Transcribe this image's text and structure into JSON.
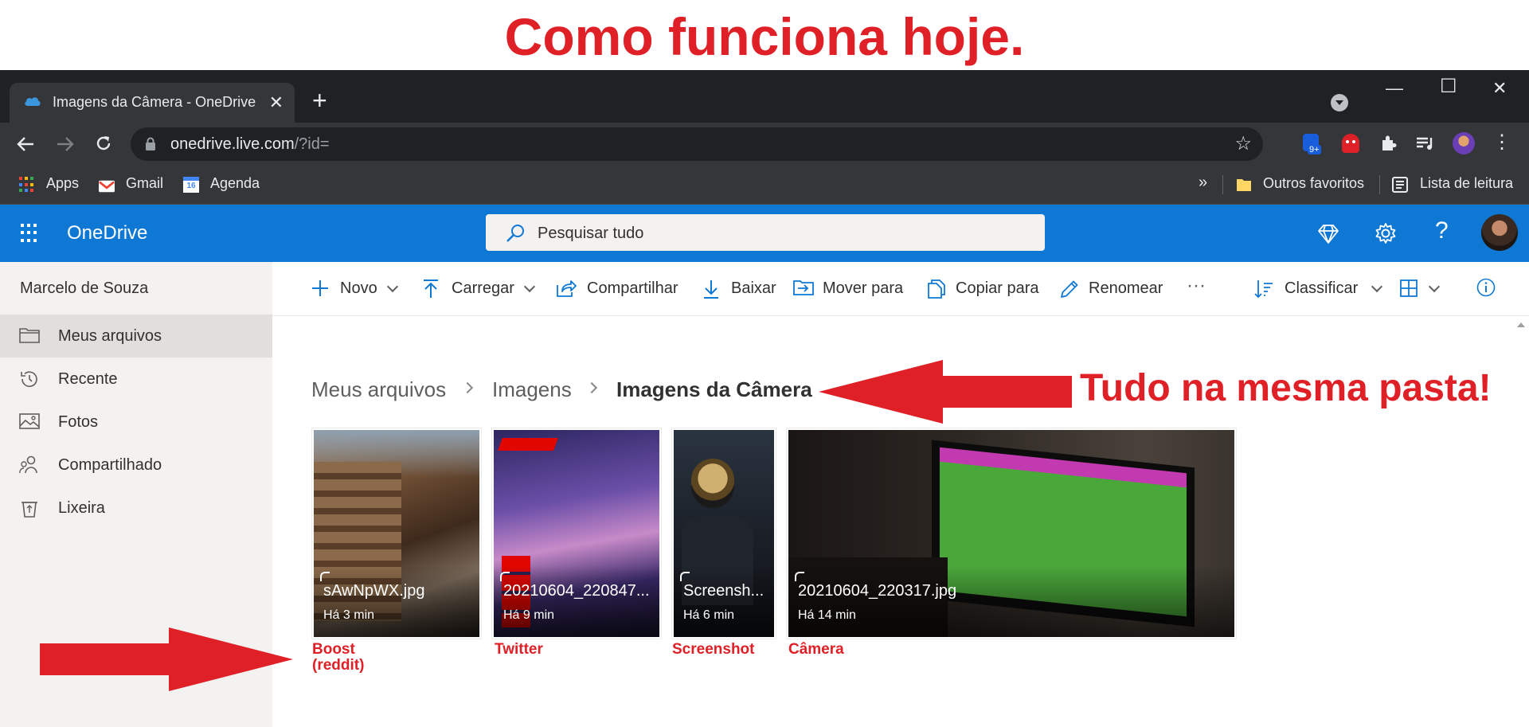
{
  "annotation": {
    "headline": "Como funciona hoje.",
    "note": "Tudo na mesma pasta!",
    "tags": [
      {
        "line1": "Boost",
        "line2": "(reddit)"
      },
      {
        "line1": "Twitter",
        "line2": ""
      },
      {
        "line1": "Screenshot",
        "line2": ""
      },
      {
        "line1": "Câmera",
        "line2": ""
      }
    ],
    "accent_color": "#e02027"
  },
  "browser": {
    "tab_title": "Imagens da Câmera - OneDrive",
    "tab_close": "✕",
    "new_tab": "+",
    "window_controls": {
      "minimize": "—",
      "maximize": "☐",
      "close": "✕"
    },
    "url_host": "onedrive.live.com",
    "url_rest": "/?id=",
    "extension_badge": "9+",
    "bookmarks": {
      "apps": "Apps",
      "gmail": "Gmail",
      "agenda": "Agenda",
      "agenda_day": "16",
      "more": "»",
      "outros": "Outros favoritos",
      "lista": "Lista de leitura"
    }
  },
  "onedrive": {
    "brand": "OneDrive",
    "brand_color": "#0f78d4",
    "search_placeholder": "Pesquisar tudo",
    "user_name": "Marcelo de Souza",
    "nav": [
      {
        "label": "Meus arquivos",
        "icon": "folder-icon",
        "selected": true
      },
      {
        "label": "Recente",
        "icon": "history-icon",
        "selected": false
      },
      {
        "label": "Fotos",
        "icon": "photo-icon",
        "selected": false
      },
      {
        "label": "Compartilhado",
        "icon": "people-icon",
        "selected": false
      },
      {
        "label": "Lixeira",
        "icon": "recycle-bin-icon",
        "selected": false
      }
    ],
    "commands": {
      "novo": "Novo",
      "carregar": "Carregar",
      "compartilhar": "Compartilhar",
      "baixar": "Baixar",
      "mover": "Mover para",
      "copiar": "Copiar para",
      "renomear": "Renomear",
      "more": "···",
      "classificar": "Classificar"
    },
    "breadcrumb": [
      "Meus arquivos",
      "Imagens",
      "Imagens da Câmera"
    ],
    "files": [
      {
        "name": "sAwNpWX.jpg",
        "time": "Há 3 min"
      },
      {
        "name": "20210604_220847...",
        "time": "Há 9 min"
      },
      {
        "name": "Screensh...",
        "time": "Há 6 min"
      },
      {
        "name": "20210604_220317.jpg",
        "time": "Há 14 min"
      }
    ]
  }
}
